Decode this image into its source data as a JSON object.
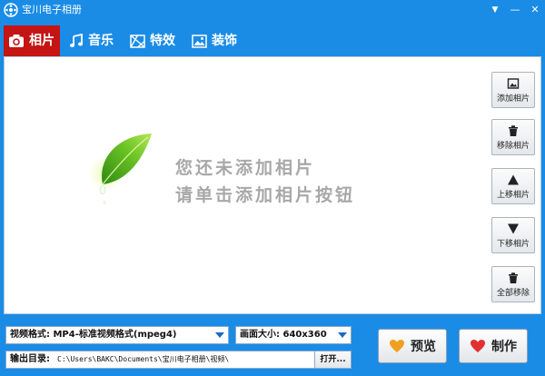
{
  "window": {
    "title": "宝川电子相册",
    "controls": {
      "dropdown": "▼",
      "minimize": "—",
      "close": "✕"
    }
  },
  "tabs": [
    {
      "label": "相片",
      "icon": "camera-icon",
      "active": true
    },
    {
      "label": "音乐",
      "icon": "music-note-icon",
      "active": false
    },
    {
      "label": "特效",
      "icon": "effects-icon",
      "active": false
    },
    {
      "label": "装饰",
      "icon": "image-icon",
      "active": false
    }
  ],
  "main": {
    "empty_line1": "您还未添加相片",
    "empty_line2": "请单击添加相片按钮",
    "side_buttons": [
      {
        "label": "添加相片",
        "icon": "add-photo-icon"
      },
      {
        "label": "移除相片",
        "icon": "trash-icon"
      },
      {
        "label": "上移相片",
        "icon": "arrow-up-icon"
      },
      {
        "label": "下移相片",
        "icon": "arrow-down-icon"
      },
      {
        "label": "全部移除",
        "icon": "trash-icon"
      }
    ]
  },
  "bottom": {
    "format_value": "视频格式: MP4-标准视频格式(mpeg4)",
    "size_value": "画面大小: 640x360",
    "output_label": "输出目录:",
    "output_path": "C:\\Users\\BAKC\\Documents\\宝川电子相册\\视频\\",
    "open_label": "打开...",
    "preview_label": "预览",
    "make_label": "制作"
  },
  "colors": {
    "accent": "#1a8ce6",
    "active_tab": "#c41414",
    "empty_text": "#a8a8a8"
  }
}
